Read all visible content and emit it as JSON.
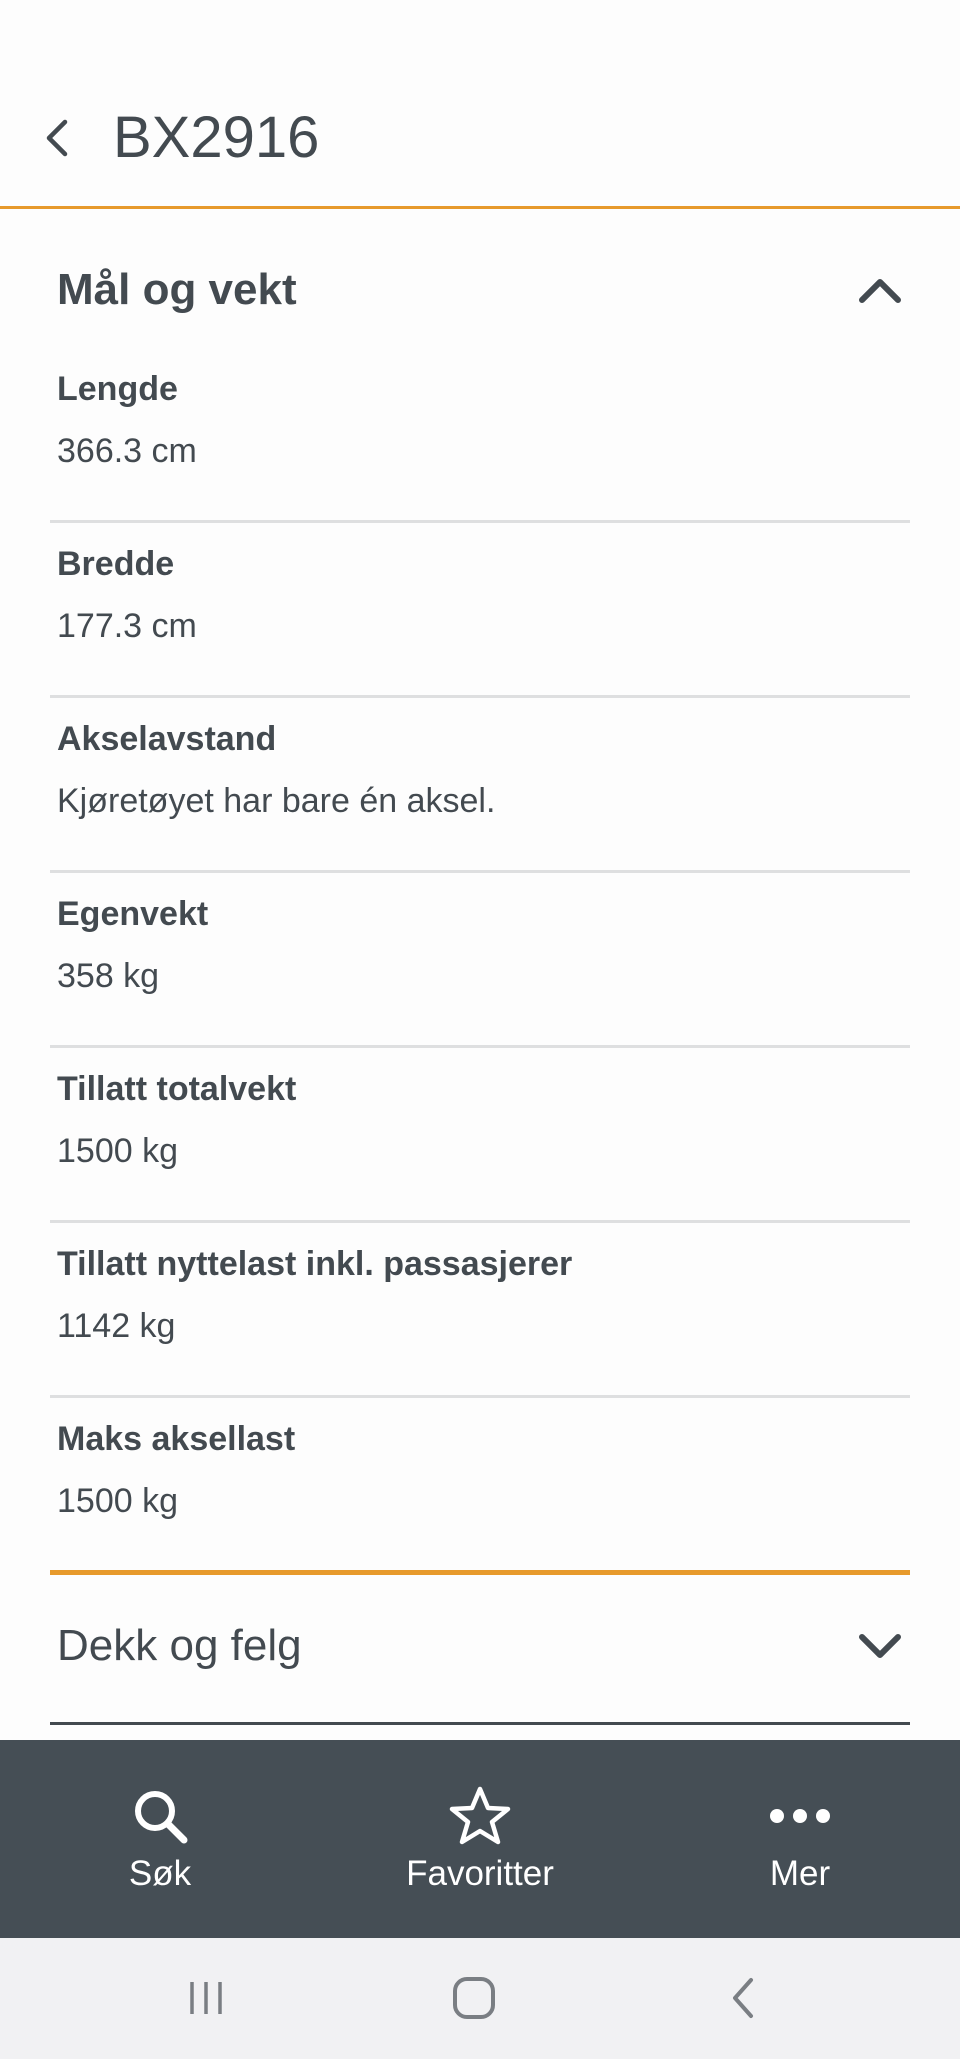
{
  "header": {
    "title": "BX2916",
    "back_icon": "chevron-left-icon"
  },
  "sections": [
    {
      "title": "Mål og vekt",
      "expanded": true,
      "toggle_icon": "chevron-up-icon",
      "rows": [
        {
          "label": "Lengde",
          "value": "366.3 cm"
        },
        {
          "label": "Bredde",
          "value": "177.3 cm"
        },
        {
          "label": "Akselavstand",
          "value": "Kjøretøyet har bare én aksel."
        },
        {
          "label": "Egenvekt",
          "value": "358 kg"
        },
        {
          "label": "Tillatt totalvekt",
          "value": "1500 kg"
        },
        {
          "label": "Tillatt nyttelast inkl. passasjerer",
          "value": "1142 kg"
        },
        {
          "label": "Maks aksellast",
          "value": "1500 kg"
        }
      ]
    },
    {
      "title": "Dekk og felg",
      "expanded": false,
      "toggle_icon": "chevron-down-icon"
    }
  ],
  "bottom_nav": [
    {
      "label": "Søk",
      "icon": "search-icon"
    },
    {
      "label": "Favoritter",
      "icon": "star-icon"
    },
    {
      "label": "Mer",
      "icon": "more-dots-icon"
    }
  ],
  "colors": {
    "accent": "#e79a2c",
    "text": "#434a50",
    "nav_background": "#454e55",
    "divider": "#dedfe0"
  }
}
